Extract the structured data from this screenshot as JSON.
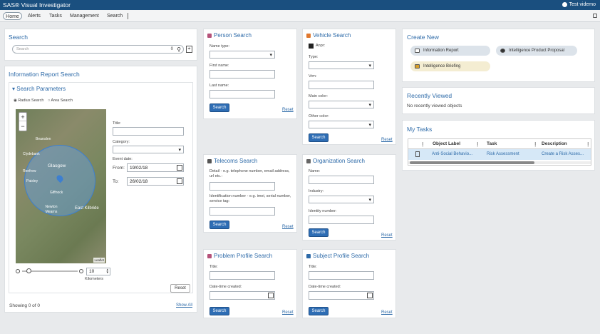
{
  "app": {
    "title": "SAS® Visual Investigator",
    "user": "Test videmo"
  },
  "nav": {
    "items": [
      "Home",
      "Alerts",
      "Tasks",
      "Management",
      "Search"
    ]
  },
  "search": {
    "title": "Search",
    "placeholder": "Search",
    "count": "0"
  },
  "report_search": {
    "title": "Information Report Search",
    "params_title": "Search Parameters",
    "radius_label": "Radius Search",
    "area_label": "Area Search",
    "title_label": "Title:",
    "category_label": "Category:",
    "event_date_label": "Event date:",
    "from_label": "From:",
    "from_value": "19/02/18",
    "to_label": "To:",
    "to_value": "26/02/18",
    "radius_value": "10",
    "kilometers": "Kilometers",
    "reset": "Reset",
    "showing": "Showing 0 of 0",
    "show_all": "Show All",
    "map_labels": [
      "Glasgow",
      "Bearsden",
      "Paisley",
      "Renfrew",
      "Giffnock",
      "Newton Mearns",
      "East Kilbride",
      "Clydebank",
      "Leaflet"
    ]
  },
  "person_search": {
    "title": "Person Search",
    "name_type": "Name type:",
    "first_name": "First name:",
    "last_name": "Last name:",
    "search": "Search",
    "reset": "Reset"
  },
  "vehicle_search": {
    "title": "Vehicle Search",
    "anpr": "Anpr:",
    "type": "Type:",
    "vrm": "Vrm:",
    "main_color": "Main color:",
    "other_color": "Other color:",
    "search": "Search",
    "reset": "Reset"
  },
  "telecoms_search": {
    "title": "Telecoms Search",
    "detail": "Detail - e.g. telephone number, email address, url etc.:",
    "identification": "Identification number - e.g. imei, serial number, service tag:",
    "search": "Search",
    "reset": "Reset"
  },
  "organization_search": {
    "title": "Organization Search",
    "name": "Name:",
    "industry": "Industry:",
    "identity": "Identity number:",
    "search": "Search",
    "reset": "Reset"
  },
  "problem_profile_search": {
    "title": "Problem Profile Search",
    "title_label": "Title:",
    "date_created": "Date-time created:",
    "search": "Search",
    "reset": "Reset"
  },
  "subject_profile_search": {
    "title": "Subject Profile Search",
    "title_label": "Title:",
    "date_created": "Date-time created:",
    "search": "Search",
    "reset": "Reset"
  },
  "create_new": {
    "title": "Create New",
    "items": [
      "Information Report",
      "Intelligence Product Proposal",
      "Intelligence Briefing"
    ]
  },
  "recently_viewed": {
    "title": "Recently Viewed",
    "empty": "No recently viewed objects"
  },
  "my_tasks": {
    "title": "My Tasks",
    "columns": [
      "Object Label",
      "Task",
      "Description"
    ],
    "rows": [
      {
        "label": "Anti-Social Behavio...",
        "task": "Risk Assessment",
        "description": "Create a Risk Asses..."
      }
    ]
  }
}
